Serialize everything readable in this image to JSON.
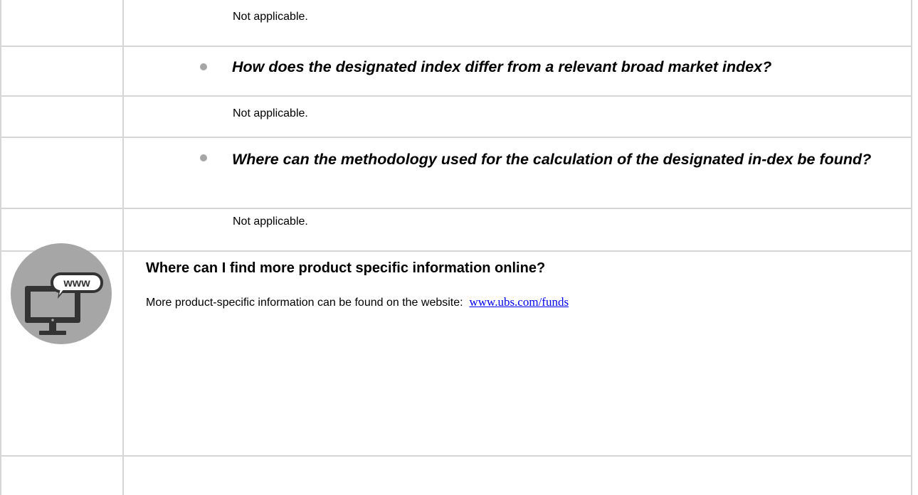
{
  "rows": [
    {
      "text": "Not applicable."
    },
    {
      "question": "How does the designated index differ from a relevant broad market index?"
    },
    {
      "text": "Not applicable."
    },
    {
      "question": "Where can the methodology used for the calculation of the designated in-dex be found?"
    },
    {
      "text": "Not applicable."
    }
  ],
  "online_section": {
    "heading": "Where can I find more product specific information online?",
    "body": "More product-specific information can be found on the website:",
    "link_text": "www.ubs.com/funds",
    "icon_label": "www"
  },
  "colors": {
    "border": "#d6d6d6",
    "bullet": "#a6a6a6",
    "icon_circle": "#a6a6a6",
    "link": "#0000ee"
  }
}
